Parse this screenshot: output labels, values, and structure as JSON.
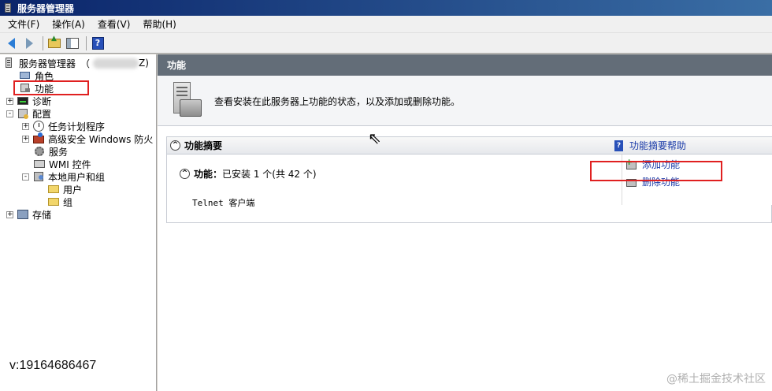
{
  "window": {
    "title": "服务器管理器"
  },
  "menu": [
    "文件(F)",
    "操作(A)",
    "查看(V)",
    "帮助(H)"
  ],
  "toolbar": {
    "buttons": [
      "back-icon",
      "forward-icon",
      "up-folder-icon",
      "show-hide-tree-icon",
      "help-icon"
    ]
  },
  "tree": {
    "root": {
      "label": "服务器管理器",
      "suffix": "（",
      "suffix_end": "Z)"
    },
    "items": [
      {
        "label": "角色",
        "icon": "roles-icon"
      },
      {
        "label": "功能",
        "icon": "features-icon",
        "selected": true
      },
      {
        "label": "诊断",
        "icon": "diagnostics-icon",
        "expand": "+"
      },
      {
        "label": "配置",
        "icon": "configuration-icon",
        "expand": "-"
      },
      {
        "label": "任务计划程序",
        "icon": "clock-icon",
        "expand": "+"
      },
      {
        "label": "高级安全 Windows 防火",
        "icon": "firewall-icon",
        "expand": "+"
      },
      {
        "label": "服务",
        "icon": "services-icon"
      },
      {
        "label": "WMI 控件",
        "icon": "wmi-icon"
      },
      {
        "label": "本地用户和组",
        "icon": "users-icon",
        "expand": "-"
      },
      {
        "label": "用户",
        "icon": "folder-icon"
      },
      {
        "label": "组",
        "icon": "folder-icon"
      },
      {
        "label": "存储",
        "icon": "storage-icon",
        "expand": "+"
      }
    ]
  },
  "main": {
    "header": "功能",
    "intro": "查看安装在此服务器上功能的状态，以及添加或删除功能。",
    "summary": {
      "title": "功能摘要",
      "collapse_glyph": "^",
      "help_link": "功能摘要帮助",
      "installed_label": "功能：",
      "installed_text": "已安装 1 个(共 42 个)",
      "features": [
        "Telnet 客户端"
      ],
      "actions": [
        "添加功能",
        "删除功能"
      ]
    }
  },
  "overlay": {
    "contact": "v:19164686467",
    "watermark": "@稀土掘金技术社区"
  },
  "colors": {
    "title_bar": "#0a246a",
    "header_bar": "#636d78",
    "link": "#1a3aa8",
    "highlight_box": "#e02020"
  }
}
